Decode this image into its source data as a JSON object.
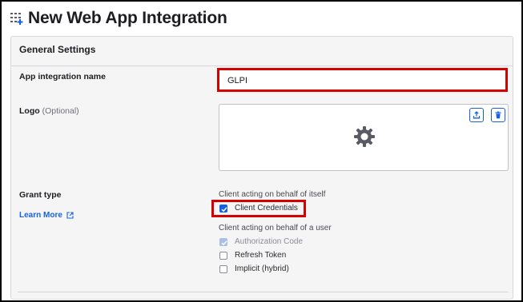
{
  "header": {
    "title": "New Web App Integration",
    "icon": "grid-plus-icon"
  },
  "general": {
    "section_title": "General Settings",
    "app_name_label": "App integration name",
    "app_name_value": "GLPI",
    "logo_label": "Logo",
    "logo_optional": "(Optional)",
    "logo_icons": [
      "upload-icon",
      "trash-icon",
      "gear-icon"
    ]
  },
  "grant": {
    "label": "Grant type",
    "learn_more": "Learn More",
    "self_heading": "Client acting on behalf of itself",
    "user_heading": "Client acting on behalf of a user",
    "options": [
      {
        "label": "Client Credentials",
        "checked": true,
        "disabled": false
      },
      {
        "label": "Authorization Code",
        "checked": true,
        "disabled": true
      },
      {
        "label": "Refresh Token",
        "checked": false,
        "disabled": false
      },
      {
        "label": "Implicit (hybrid)",
        "checked": false,
        "disabled": false
      }
    ]
  },
  "colors": {
    "accent": "#1662dd",
    "highlight": "#d50000"
  }
}
